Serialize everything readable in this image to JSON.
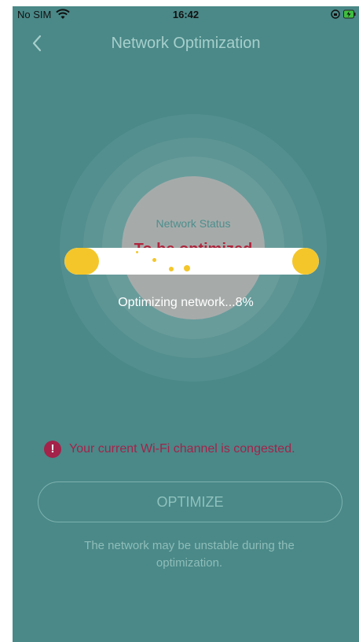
{
  "status_bar": {
    "carrier": "No SIM",
    "time": "16:42",
    "wifi_icon": "wifi-icon",
    "rotation_icon": "rotation-lock-icon",
    "battery_icon": "battery-charging-icon"
  },
  "nav": {
    "back_icon": "chevron-left-icon",
    "title": "Network Optimization"
  },
  "network_status": {
    "label": "Network Status",
    "value": "To be optimized"
  },
  "progress": {
    "text": "Optimizing network...8%",
    "percent": 8
  },
  "warning": {
    "icon": "exclamation-icon",
    "icon_glyph": "!",
    "text": "Your current Wi-Fi channel is congested."
  },
  "optimize_button": {
    "label": "OPTIMIZE"
  },
  "note": {
    "text": "The network may be unstable during the optimization."
  },
  "colors": {
    "background": "#4a8988",
    "accent_yellow": "#f4c62a",
    "warning": "#a3234a",
    "title": "#a7cfcc"
  }
}
